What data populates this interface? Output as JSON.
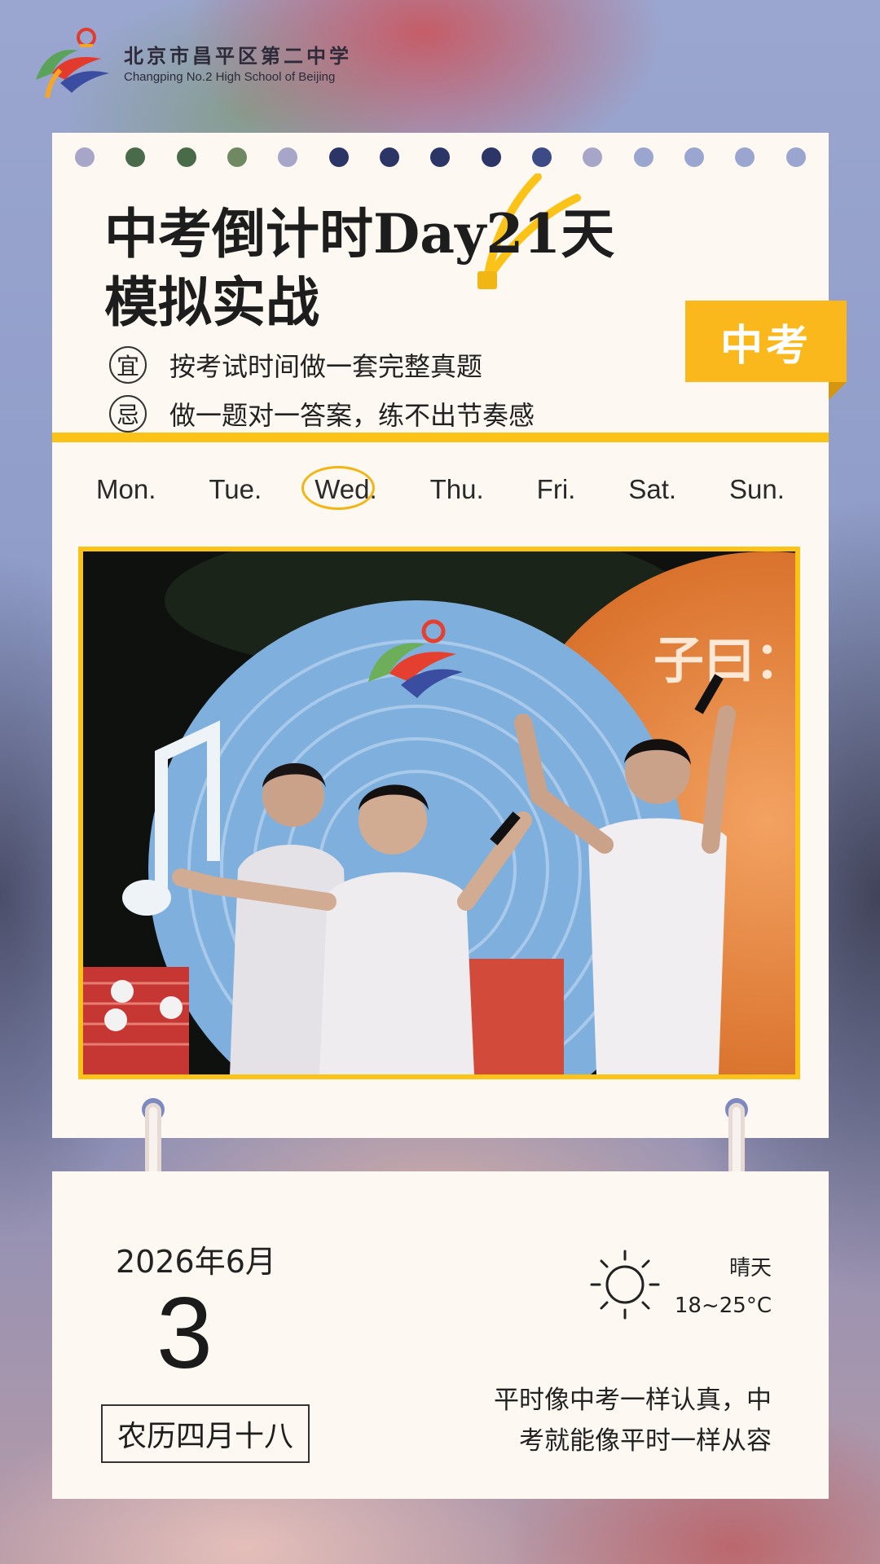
{
  "logo": {
    "name_cn": "北京市昌平区第二中学",
    "name_en": "Changping No.2 High School of Beijing"
  },
  "calendar": {
    "title_line1": "中考倒计时Day21天",
    "title_line2": "模拟实战",
    "tag": "中考",
    "do_label": "宜",
    "do_text": "按考试时间做一套完整真题",
    "avoid_label": "忌",
    "avoid_text": "做一题对一答案，练不出节奏感",
    "weekdays": [
      "Mon.",
      "Tue.",
      "Wed.",
      "Thu.",
      "Fri.",
      "Sat.",
      "Sun."
    ],
    "active_weekday": "Wed.",
    "photo": {
      "stage_text": "子曰："
    }
  },
  "date": {
    "year_month": "2026年6月",
    "day": "3",
    "lunar": "农历四月十八"
  },
  "weather": {
    "condition": "晴天",
    "temperature": "18~25°C",
    "icon": "sun-icon"
  },
  "quote": {
    "line1": "平时像中考一样认真，中",
    "line2": "考就能像平时一样从容"
  },
  "colors": {
    "accent_yellow": "#fbc318",
    "tag_yellow": "#fbb81c",
    "card_bg": "#fdf8f1",
    "hole_colors": [
      "#a7a6c8",
      "#4a6b4a",
      "#4a6b4a",
      "#6f8a62",
      "#a7a6c8",
      "#2b3566",
      "#2b3566",
      "#2b3566",
      "#2b3566",
      "#3c4a85",
      "#a7a6c8",
      "#9aa6cf",
      "#9aa6cf",
      "#9aa6cf",
      "#9aa6cf"
    ]
  }
}
